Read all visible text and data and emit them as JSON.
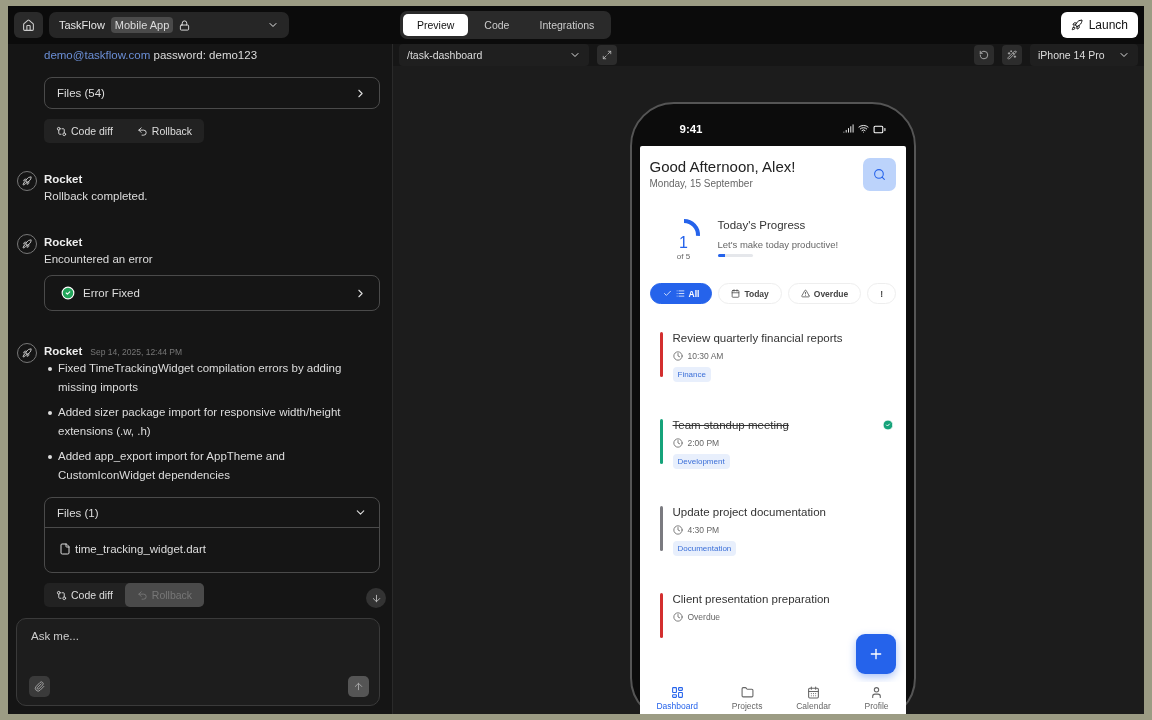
{
  "header": {
    "project": "TaskFlow",
    "badge": "Mobile App",
    "tabs": [
      {
        "label": "Preview",
        "selected": true
      },
      {
        "label": "Code",
        "selected": false
      },
      {
        "label": "Integrations",
        "selected": false
      }
    ],
    "launch": "Launch"
  },
  "chat": {
    "credentials": {
      "email": "demo@taskflow.com",
      "rest": "password: demo123"
    },
    "blocks": [
      {
        "kind": "files",
        "label": "Files (54)",
        "expanded": false
      },
      {
        "kind": "actions",
        "buttons": [
          {
            "label": "Code diff",
            "disabled": false
          },
          {
            "label": "Rollback",
            "disabled": false
          }
        ]
      },
      {
        "kind": "message",
        "author": "Rocket",
        "text": "Rollback completed."
      },
      {
        "kind": "message",
        "author": "Rocket",
        "text": "Encountered an error"
      },
      {
        "kind": "status",
        "label": "Error Fixed"
      },
      {
        "kind": "message",
        "author": "Rocket",
        "time": "Sep 14, 2025, 12:44 PM",
        "bullets": [
          "Fixed TimeTrackingWidget compilation errors by adding missing imports",
          "Added sizer package import for responsive width/height extensions (.w, .h)",
          "Added app_export import for AppTheme and CustomIconWidget dependencies"
        ]
      },
      {
        "kind": "files",
        "label": "Files (1)",
        "expanded": true,
        "files": [
          "time_tracking_widget.dart"
        ]
      },
      {
        "kind": "actions",
        "buttons": [
          {
            "label": "Code diff",
            "disabled": false
          },
          {
            "label": "Rollback",
            "disabled": true
          }
        ]
      }
    ],
    "input": {
      "placeholder": "Ask me..."
    }
  },
  "preview": {
    "route": "/task-dashboard",
    "device": "iPhone 14 Pro"
  },
  "phone": {
    "time": "9:41",
    "greeting": "Good Afternoon, Alex!",
    "date": "Monday, 15 September",
    "progress": {
      "count": "1",
      "of": "of 5",
      "level": 0.2,
      "title": "Today's Progress",
      "subtitle": "Let's make today productive!"
    },
    "filters": [
      {
        "label": "All",
        "selected": true
      },
      {
        "label": "Today",
        "selected": false
      },
      {
        "label": "Overdue",
        "selected": false
      },
      {
        "label": "!",
        "selected": false
      }
    ],
    "tasks": [
      {
        "title": "Review quarterly financial reports",
        "time": "10:30 AM",
        "tag": "Finance",
        "color": "#d32f2f",
        "done": false
      },
      {
        "title": "Team standup meeting",
        "time": "2:00 PM",
        "tag": "Development",
        "color": "#16a37a",
        "done": true
      },
      {
        "title": "Update project documentation",
        "time": "4:30 PM",
        "tag": "Documentation",
        "color": "#7a7a80",
        "done": false
      },
      {
        "title": "Client presentation preparation",
        "time": "Overdue",
        "color": "#d32f2f",
        "done": false
      }
    ],
    "nav": [
      {
        "label": "Dashboard",
        "selected": true
      },
      {
        "label": "Projects",
        "selected": false
      },
      {
        "label": "Calendar",
        "selected": false
      },
      {
        "label": "Profile",
        "selected": false
      }
    ]
  }
}
